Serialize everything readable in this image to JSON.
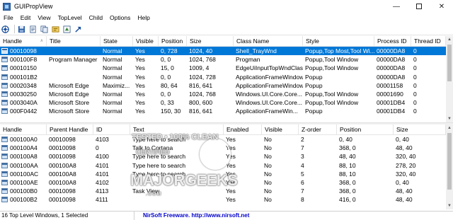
{
  "window": {
    "title": "GUIPropView"
  },
  "menu": [
    "File",
    "Edit",
    "View",
    "TopLevel",
    "Child",
    "Options",
    "Help"
  ],
  "toolbar_icons": [
    "target-icon",
    "save-icon",
    "report-icon",
    "copy-icon",
    "properties-icon",
    "refresh-icon",
    "jump-icon"
  ],
  "top_table": {
    "columns": [
      "Handle",
      "Title",
      "State",
      "Visible",
      "Position",
      "Size",
      "Class Name",
      "Style",
      "Process ID",
      "Thread ID"
    ],
    "rows": [
      [
        "00010098",
        "",
        "Normal",
        "Yes",
        "0, 728",
        "1024, 40",
        "Shell_TrayWnd",
        "Popup,Top Most,Tool Wi...",
        "00000DA8",
        "0"
      ],
      [
        "000100F8",
        "Program Manager",
        "Normal",
        "Yes",
        "0, 0",
        "1024, 768",
        "Progman",
        "Popup,Tool Window",
        "00000DA8",
        "0"
      ],
      [
        "00010150",
        "",
        "Normal",
        "Yes",
        "15, 0",
        "1009, 4",
        "EdgeUiInputTopWndClass",
        "Popup,Tool Window",
        "00000DA8",
        "0"
      ],
      [
        "000101B2",
        "",
        "Normal",
        "Yes",
        "0, 0",
        "1024, 728",
        "ApplicationFrameWindow",
        "Popup",
        "00000DA8",
        "0"
      ],
      [
        "00020348",
        "Microsoft Edge",
        "Maximiz...",
        "Yes",
        "80, 64",
        "816, 641",
        "ApplicationFrameWindow",
        "Popup",
        "00001158",
        "0"
      ],
      [
        "00030250",
        "Microsoft Edge",
        "Normal",
        "Yes",
        "0, 0",
        "1024, 768",
        "Windows.UI.Core.Core...",
        "Popup,Tool Window",
        "00001690",
        "0"
      ],
      [
        "0003040A",
        "Microsoft Store",
        "Normal",
        "Yes",
        "0, 33",
        "800, 600",
        "Windows.UI.Core.Core...",
        "Popup,Tool Window",
        "00001DB4",
        "0"
      ],
      [
        "000F0442",
        "Microsoft Store",
        "Normal",
        "Yes",
        "150, 30",
        "816, 641",
        "ApplicationFrameWin...",
        "Popup",
        "00001DB4",
        "0"
      ]
    ]
  },
  "bottom_table": {
    "columns": [
      "Handle",
      "Parent Handle",
      "ID",
      "Text",
      "Enabled",
      "Visible",
      "Z-order",
      "Position",
      "Size"
    ],
    "rows": [
      [
        "000100A0",
        "00010098",
        "4103",
        "Type here to search",
        "Yes",
        "No",
        "2",
        "0, 40",
        "0, 40"
      ],
      [
        "000100A4",
        "00010098",
        "0",
        "Talk to Cortana",
        "Yes",
        "No",
        "7",
        "368, 0",
        "48, 40"
      ],
      [
        "000100A8",
        "00010098",
        "4100",
        "Type here to search",
        "Yes",
        "No",
        "3",
        "48, 40",
        "320, 40"
      ],
      [
        "000100AA",
        "000100A8",
        "4101",
        "Type here to search",
        "Yes",
        "No",
        "4",
        "88, 10",
        "278, 20"
      ],
      [
        "000100AC",
        "000100A8",
        "4101",
        "Type here to search",
        "Yes",
        "No",
        "5",
        "88, 10",
        "320, 40"
      ],
      [
        "000100AE",
        "000100A8",
        "4102",
        "",
        "Yes",
        "No",
        "6",
        "368, 0",
        "0, 40"
      ],
      [
        "000100B0",
        "00010098",
        "4113",
        "Task View",
        "Yes",
        "No",
        "7",
        "368, 0",
        "48, 40"
      ],
      [
        "000100B2",
        "00010098",
        "4111",
        "",
        "Yes",
        "No",
        "8",
        "416, 0",
        "48, 40"
      ]
    ]
  },
  "status": {
    "left": "16 Top Level Windows, 1 Selected",
    "link": "NirSoft Freeware.  http://www.nirsoft.net"
  },
  "watermark": {
    "line1": "TESTED • 100% CLEAN",
    "line2": "CERTIFIED",
    "line3": "MAJORGEEKS",
    "line4": ".COM"
  },
  "colors": {
    "selection": "#0078d7",
    "link": "#0000cc"
  }
}
